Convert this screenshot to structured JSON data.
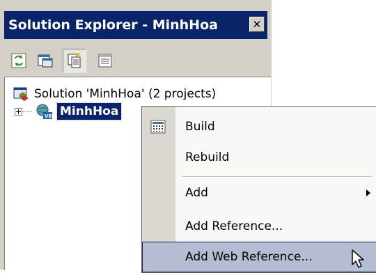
{
  "window": {
    "title": "Solution Explorer - MinhHoa",
    "close_glyph": "✕"
  },
  "toolbar": {
    "buttons": [
      {
        "name": "refresh-icon"
      },
      {
        "name": "view-code-icon"
      },
      {
        "name": "show-all-files-icon",
        "pressed": true
      },
      {
        "name": "properties-icon"
      }
    ]
  },
  "tree": {
    "solution_label": "Solution 'MinhHoa' (2 projects)",
    "project_label": "MinhHoa"
  },
  "context_menu": {
    "items": [
      {
        "label": "Build",
        "icon": "build-icon"
      },
      {
        "label": "Rebuild"
      },
      {
        "label": "Add",
        "submenu": true
      },
      {
        "label": "Add Reference..."
      },
      {
        "label": "Add Web Reference...",
        "highlighted": true
      }
    ]
  },
  "colors": {
    "titlebar": "#0a246a",
    "menu_highlight": "#b6bdd2",
    "menu_gutter": "#dbd8d1",
    "chrome": "#d4d0c8"
  }
}
